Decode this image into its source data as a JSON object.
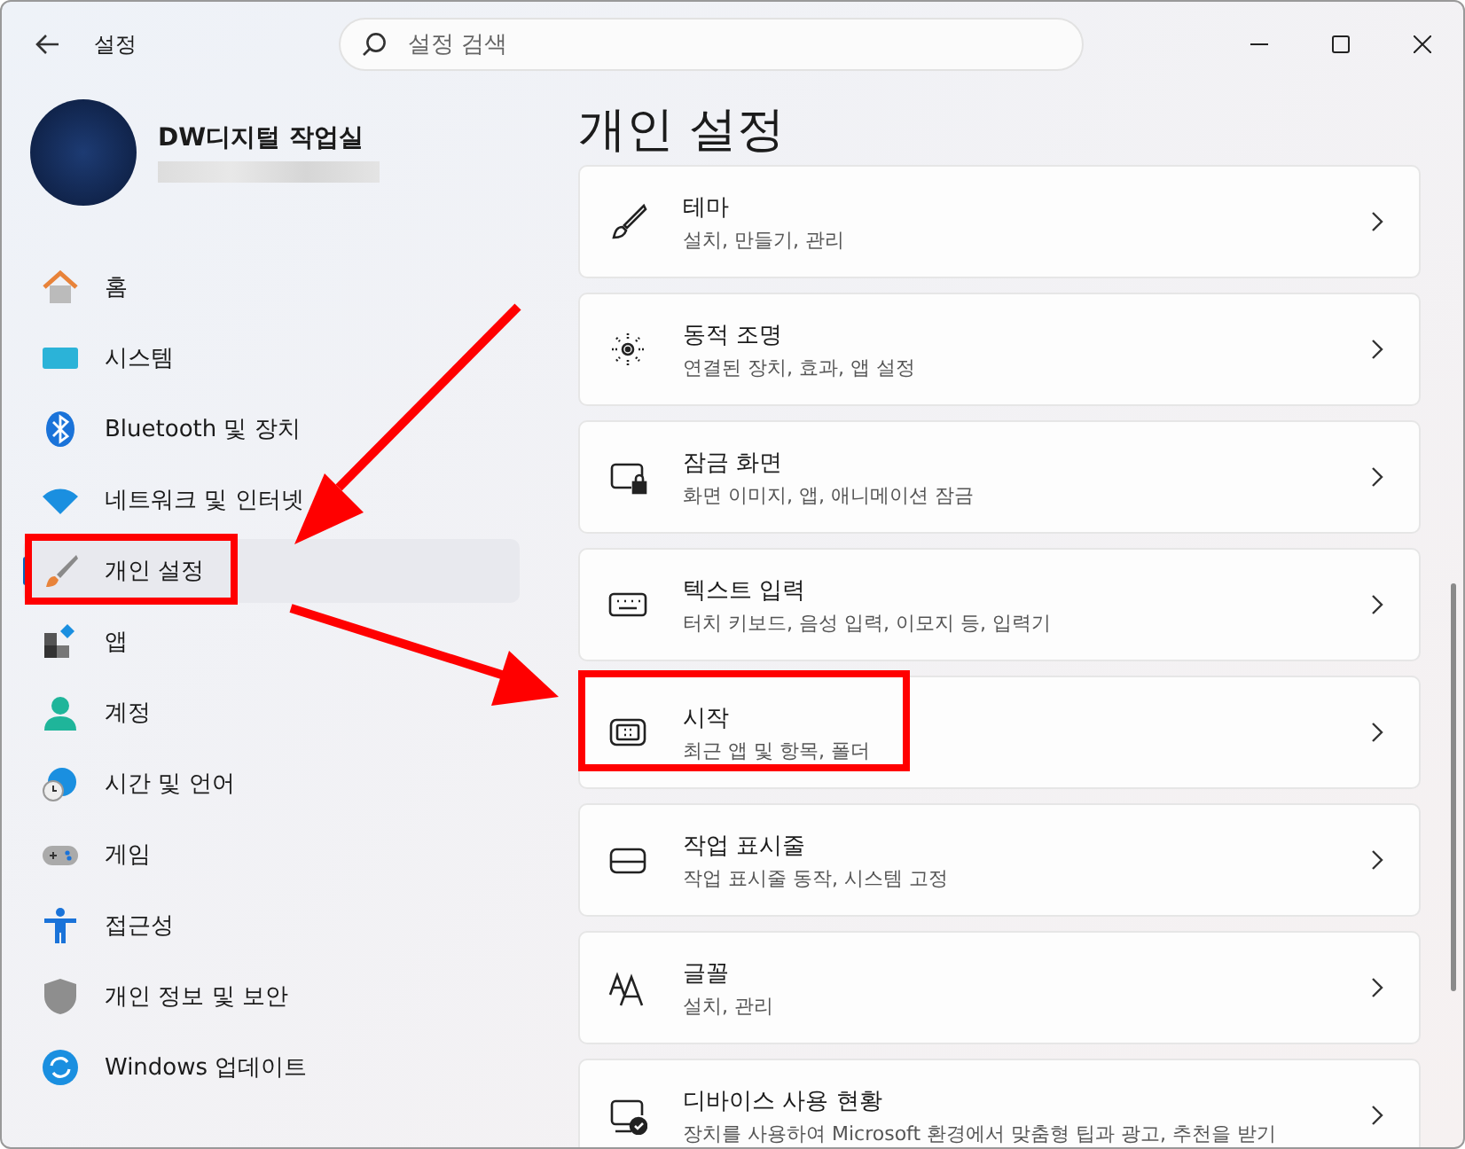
{
  "window": {
    "title": "설정"
  },
  "search": {
    "placeholder": "설정 검색"
  },
  "profile": {
    "name": "DW디지털 작업실"
  },
  "sidebar": {
    "items": [
      {
        "label": "홈",
        "selected": false
      },
      {
        "label": "시스템",
        "selected": false
      },
      {
        "label": "Bluetooth 및 장치",
        "selected": false
      },
      {
        "label": "네트워크 및 인터넷",
        "selected": false
      },
      {
        "label": "개인 설정",
        "selected": true
      },
      {
        "label": "앱",
        "selected": false
      },
      {
        "label": "계정",
        "selected": false
      },
      {
        "label": "시간 및 언어",
        "selected": false
      },
      {
        "label": "게임",
        "selected": false
      },
      {
        "label": "접근성",
        "selected": false
      },
      {
        "label": "개인 정보 및 보안",
        "selected": false
      },
      {
        "label": "Windows 업데이트",
        "selected": false
      }
    ]
  },
  "page": {
    "title": "개인 설정",
    "cards": [
      {
        "title": "테마",
        "description": "설치, 만들기, 관리"
      },
      {
        "title": "동적 조명",
        "description": "연결된 장치, 효과, 앱 설정"
      },
      {
        "title": "잠금 화면",
        "description": "화면 이미지, 앱, 애니메이션 잠금"
      },
      {
        "title": "텍스트 입력",
        "description": "터치 키보드, 음성 입력, 이모지 등, 입력기"
      },
      {
        "title": "시작",
        "description": "최근 앱 및 항목, 폴더"
      },
      {
        "title": "작업 표시줄",
        "description": "작업 표시줄 동작, 시스템 고정"
      },
      {
        "title": "글꼴",
        "description": "설치, 관리"
      },
      {
        "title": "디바이스 사용 현황",
        "description": "장치를 사용하여 Microsoft 환경에서 맞춤형 팁과 광고, 추천을 받기"
      }
    ]
  }
}
